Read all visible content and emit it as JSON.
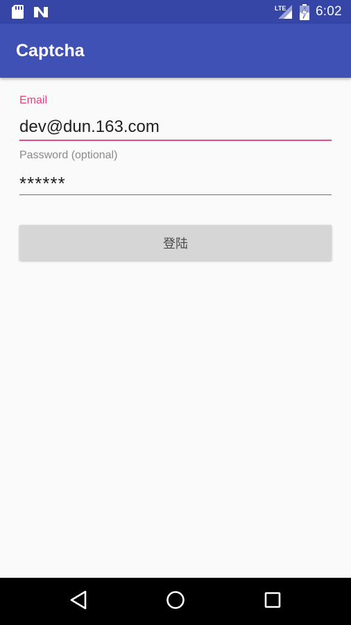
{
  "status_bar": {
    "network_type": "LTE",
    "time": "6:02",
    "icons": [
      "sd-card-icon",
      "n-notification-icon",
      "lte-signal-icon",
      "battery-charging-icon"
    ]
  },
  "app_bar": {
    "title": "Captcha"
  },
  "form": {
    "email": {
      "label": "Email",
      "value": "dev@dun.163.com"
    },
    "password": {
      "label": "Password (optional)",
      "value": "******"
    },
    "login_button_label": "登陆"
  },
  "nav_bar": {
    "icons": [
      "back-icon",
      "home-icon",
      "recents-icon"
    ]
  },
  "colors": {
    "status_bar": "#3546a6",
    "app_bar": "#3f51b5",
    "accent": "#e91e63",
    "background": "#fafafa",
    "button": "#d6d6d6"
  }
}
